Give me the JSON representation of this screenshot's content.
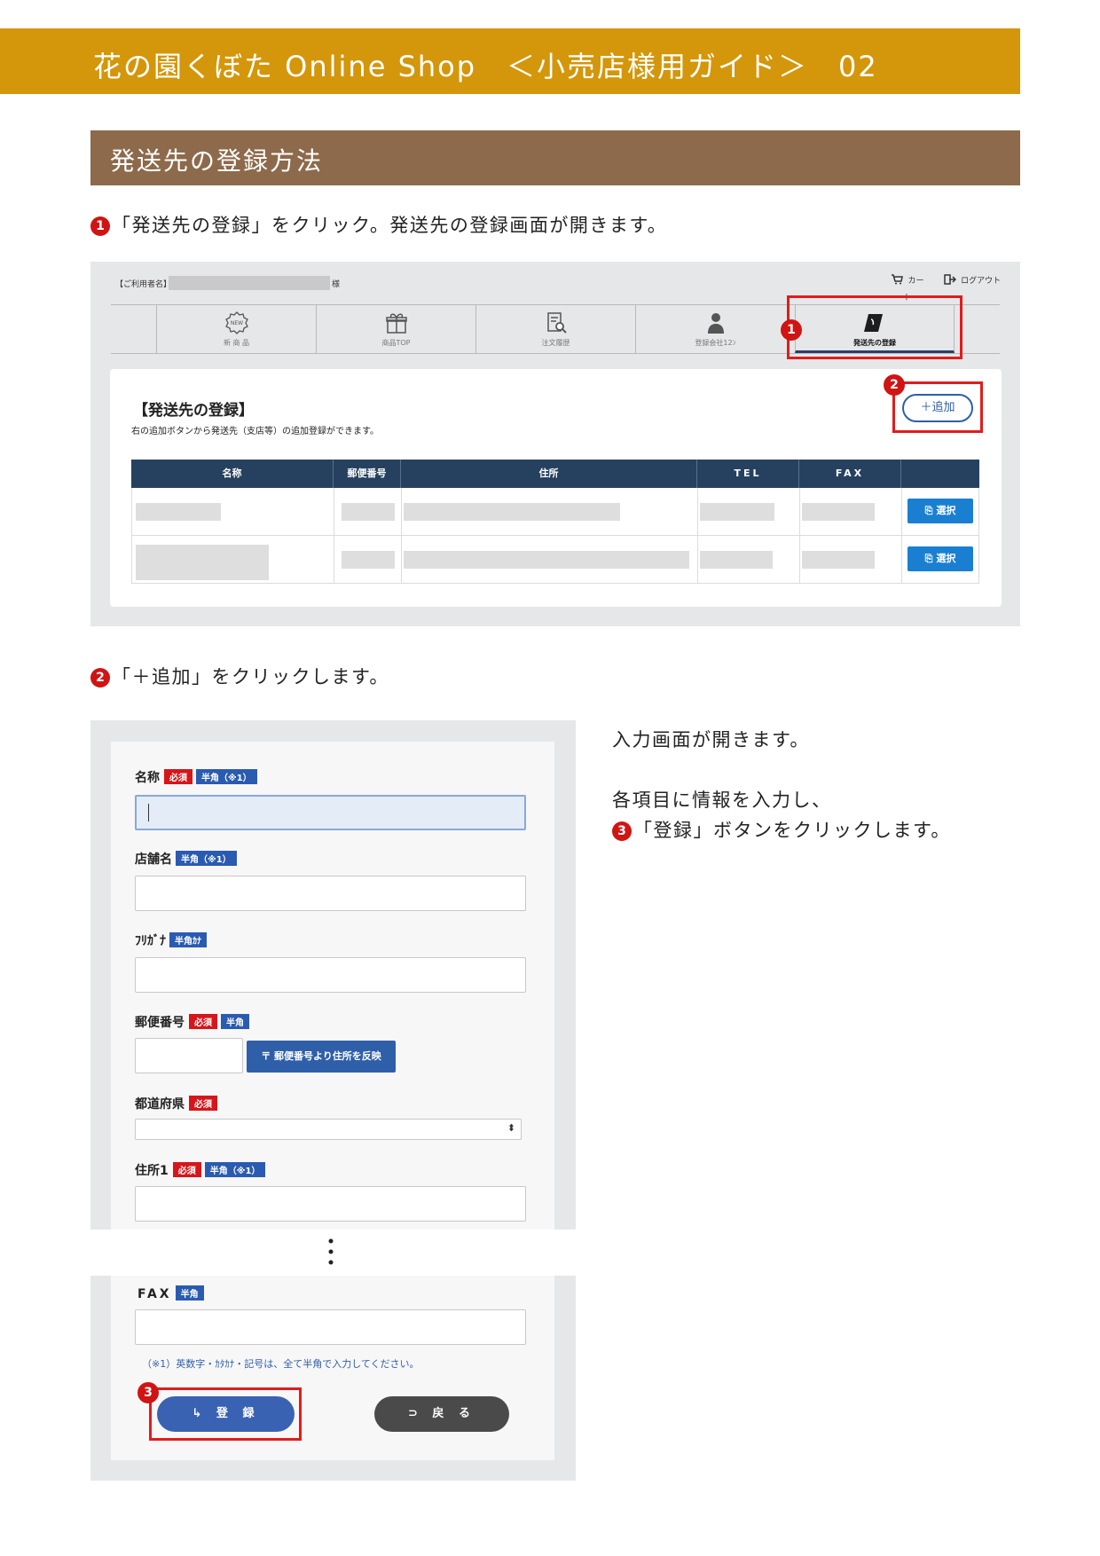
{
  "header": {
    "title": "花の園くぼた Online Shop　＜小売店様用ガイド＞　02"
  },
  "section": {
    "title": "発送先の登録方法"
  },
  "step1": {
    "num": "1",
    "text": "「発送先の登録」をクリック。発送先の登録画面が開きます。"
  },
  "step2": {
    "num": "2",
    "text": "「＋追加」をクリックします。"
  },
  "screen1": {
    "user_label": "【ご利用者名】",
    "user_suffix": "様",
    "cart_label": "カート",
    "logout_label": "ログアウト",
    "nav": [
      {
        "label": "新 商 品",
        "icon": "new-badge-icon"
      },
      {
        "label": "商品TOP",
        "icon": "gift-box-icon"
      },
      {
        "label": "注文履歴",
        "icon": "order-history-icon"
      },
      {
        "label": "登録会社12ﾝ",
        "icon": "person-icon"
      },
      {
        "label": "発送先の登録",
        "icon": "phonebook-icon"
      }
    ],
    "badge1": "1",
    "badge2": "2",
    "panel_title": "【発送先の登録】",
    "panel_desc": "右の追加ボタンから発送先（支店等）の追加登録ができます。",
    "add_button": "＋追加",
    "table_headers": [
      "名称",
      "郵便番号",
      "住所",
      "TEL",
      "FAX",
      ""
    ],
    "select_button": "選択"
  },
  "screen2": {
    "fields": {
      "name": {
        "label": "名称",
        "req": "必須",
        "half": "半角（※1）"
      },
      "store": {
        "label": "店舗名",
        "half": "半角（※1）"
      },
      "furigana": {
        "label": "ﾌﾘｶﾞﾅ",
        "half": "半角ｶﾅ"
      },
      "zip": {
        "label": "郵便番号",
        "req": "必須",
        "half": "半角",
        "button": "〒 郵便番号より住所を反映"
      },
      "pref": {
        "label": "都道府県",
        "req": "必須"
      },
      "addr1": {
        "label": "住所1",
        "req": "必須",
        "half": "半角（※1）"
      },
      "fax": {
        "label": "FAX",
        "half": "半角"
      }
    },
    "note": "（※1）英数字・ｶﾀｶﾅ・記号は、全て半角で入力してください。",
    "badge3": "3",
    "register_button": "↳ 登 録",
    "back_button": "⊃ 戻 る"
  },
  "side": {
    "line1": "入力画面が開きます。",
    "line2": "各項目に情報を入力し、",
    "num": "3",
    "line3": "「登録」ボタンをクリックします。"
  },
  "colors": {
    "header": "#d4960a",
    "section": "#8d6a4b",
    "accent_red": "#e01c1c",
    "table_head": "#26415f",
    "button_blue": "#1a7fd1"
  }
}
